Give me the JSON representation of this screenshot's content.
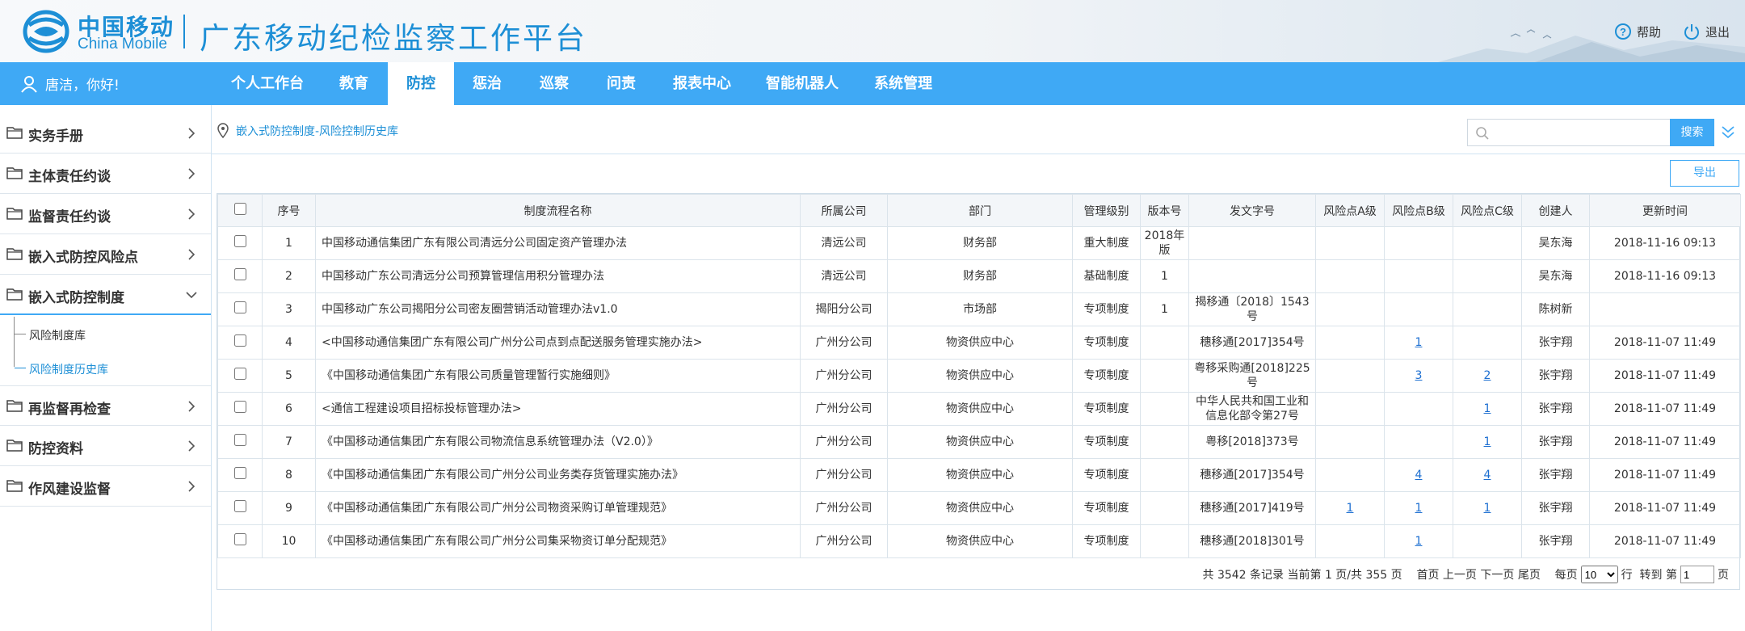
{
  "header": {
    "logo_cn": "中国移动",
    "logo_en": "China Mobile",
    "title": "广东移动纪检监察工作平台",
    "help_label": "帮助",
    "logout_label": "退出"
  },
  "nav": {
    "greeting": "唐洁，你好!",
    "items": [
      {
        "label": "个人工作台"
      },
      {
        "label": "教育"
      },
      {
        "label": "防控",
        "active": true
      },
      {
        "label": "惩治"
      },
      {
        "label": "巡察"
      },
      {
        "label": "问责"
      },
      {
        "label": "报表中心"
      },
      {
        "label": "智能机器人"
      },
      {
        "label": "系统管理"
      }
    ]
  },
  "sidebar": {
    "items": [
      {
        "label": "实务手册"
      },
      {
        "label": "主体责任约谈"
      },
      {
        "label": "监督责任约谈"
      },
      {
        "label": "嵌入式防控风险点"
      },
      {
        "label": "嵌入式防控制度",
        "expanded": true
      },
      {
        "label": "再监督再检查"
      },
      {
        "label": "防控资料"
      },
      {
        "label": "作风建设监督"
      }
    ],
    "sub_items": [
      {
        "label": "风险制度库"
      },
      {
        "label": "风险制度历史库",
        "active": true
      }
    ]
  },
  "breadcrumb": "嵌入式防控制度-风险控制历史库",
  "search": {
    "placeholder": "",
    "value": "",
    "button": "搜索"
  },
  "export_label": "导出",
  "table": {
    "headers": [
      "序号",
      "制度流程名称",
      "所属公司",
      "部门",
      "管理级别",
      "版本号",
      "发文字号",
      "风险点A级",
      "风险点B级",
      "风险点C级",
      "创建人",
      "更新时间"
    ],
    "rows": [
      {
        "no": "1",
        "name": "中国移动通信集团广东有限公司清远分公司固定资产管理办法",
        "company": "清远公司",
        "dept": "财务部",
        "level": "重大制度",
        "version": "2018年版",
        "doc": "",
        "a": "",
        "b": "",
        "c": "",
        "creator": "吴东海",
        "updated": "2018-11-16 09:13"
      },
      {
        "no": "2",
        "name": "中国移动广东公司清远分公司预算管理信用积分管理办法",
        "company": "清远公司",
        "dept": "财务部",
        "level": "基础制度",
        "version": "1",
        "doc": "",
        "a": "",
        "b": "",
        "c": "",
        "creator": "吴东海",
        "updated": "2018-11-16 09:13"
      },
      {
        "no": "3",
        "name": "中国移动广东公司揭阳分公司密友圈营销活动管理办法v1.0",
        "company": "揭阳分公司",
        "dept": "市场部",
        "level": "专项制度",
        "version": "1",
        "doc": "揭移通〔2018〕1543号",
        "a": "",
        "b": "",
        "c": "",
        "creator": "陈树新",
        "updated": ""
      },
      {
        "no": "4",
        "name": "<中国移动通信集团广东有限公司广州分公司点到点配送服务管理实施办法>",
        "company": "广州分公司",
        "dept": "物资供应中心",
        "level": "专项制度",
        "version": "",
        "doc": "穗移通[2017]354号",
        "a": "",
        "b": "1",
        "c": "",
        "creator": "张宇翔",
        "updated": "2018-11-07 11:49"
      },
      {
        "no": "5",
        "name": "《中国移动通信集团广东有限公司质量管理暂行实施细则》",
        "company": "广州分公司",
        "dept": "物资供应中心",
        "level": "专项制度",
        "version": "",
        "doc": "粤移采购通[2018]225号",
        "a": "",
        "b": "3",
        "c": "2",
        "creator": "张宇翔",
        "updated": "2018-11-07 11:49"
      },
      {
        "no": "6",
        "name": "<通信工程建设项目招标投标管理办法>",
        "company": "广州分公司",
        "dept": "物资供应中心",
        "level": "专项制度",
        "version": "",
        "doc": "中华人民共和国工业和信息化部令第27号",
        "a": "",
        "b": "",
        "c": "1",
        "creator": "张宇翔",
        "updated": "2018-11-07 11:49"
      },
      {
        "no": "7",
        "name": "《中国移动通信集团广东有限公司物流信息系统管理办法（V2.0）》",
        "company": "广州分公司",
        "dept": "物资供应中心",
        "level": "专项制度",
        "version": "",
        "doc": "粤移[2018]373号",
        "a": "",
        "b": "",
        "c": "1",
        "creator": "张宇翔",
        "updated": "2018-11-07 11:49"
      },
      {
        "no": "8",
        "name": "《中国移动通信集团广东有限公司广州分公司业务类存货管理实施办法》",
        "company": "广州分公司",
        "dept": "物资供应中心",
        "level": "专项制度",
        "version": "",
        "doc": "穗移通[2017]354号",
        "a": "",
        "b": "4",
        "c": "4",
        "creator": "张宇翔",
        "updated": "2018-11-07 11:49"
      },
      {
        "no": "9",
        "name": "《中国移动通信集团广东有限公司广州分公司物资采购订单管理规范》",
        "company": "广州分公司",
        "dept": "物资供应中心",
        "level": "专项制度",
        "version": "",
        "doc": "穗移通[2017]419号",
        "a": "1",
        "b": "1",
        "c": "1",
        "creator": "张宇翔",
        "updated": "2018-11-07 11:49"
      },
      {
        "no": "10",
        "name": "《中国移动通信集团广东有限公司广州分公司集采物资订单分配规范》",
        "company": "广州分公司",
        "dept": "物资供应中心",
        "level": "专项制度",
        "version": "",
        "doc": "穗移通[2018]301号",
        "a": "",
        "b": "1",
        "c": "",
        "creator": "张宇翔",
        "updated": "2018-11-07 11:49"
      }
    ]
  },
  "pager": {
    "summary": "共 3542 条记录 当前第 1 页/共 355 页",
    "first": "首页",
    "prev": "上一页",
    "next": "下一页",
    "last": "尾页",
    "per_page_prefix": "每页",
    "per_page_value": "10",
    "per_page_suffix": "行",
    "goto_prefix": "转到 第",
    "goto_value": "1",
    "goto_suffix": "页"
  },
  "colors": {
    "brand_blue": "#1d8fd6",
    "nav_blue": "#3fa9f5",
    "link_blue": "#1d6fd1"
  }
}
